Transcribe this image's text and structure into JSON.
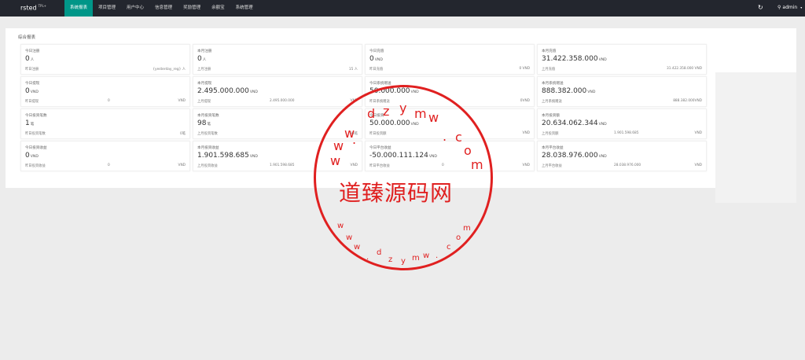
{
  "app": {
    "brand": "rsted",
    "version": "TPL+"
  },
  "nav": [
    {
      "label": "系统报表",
      "active": true
    },
    {
      "label": "项目管理",
      "active": false
    },
    {
      "label": "用户中心",
      "active": false
    },
    {
      "label": "信息管理",
      "active": false
    },
    {
      "label": "奖励管理",
      "active": false
    },
    {
      "label": "余额宝",
      "active": false
    },
    {
      "label": "系统管理",
      "active": false
    }
  ],
  "user": {
    "name": "admin"
  },
  "panel": {
    "title": "综合报表"
  },
  "cards": [
    {
      "label": "今日注册",
      "value": "0",
      "unit": "人",
      "sub_label": "昨日注册",
      "mid": "",
      "right": "{yesterday_reg} 人"
    },
    {
      "label": "本月注册",
      "value": "0",
      "unit": "人",
      "sub_label": "上月注册",
      "mid": "",
      "right": "15 人"
    },
    {
      "label": "今日充值",
      "value": "0",
      "unit": "VND",
      "sub_label": "昨日充值",
      "mid": "",
      "right": "0 VND"
    },
    {
      "label": "本月充值",
      "value": "31.422.358.000",
      "unit": "VND",
      "sub_label": "上月充值",
      "mid": "",
      "right": "31.422.358.000 VND"
    },
    {
      "label": "今日提现",
      "value": "0",
      "unit": "VND",
      "sub_label": "昨日提现",
      "mid": "0",
      "right": "VND"
    },
    {
      "label": "本月提现",
      "value": "2.495.000.000",
      "unit": "VND",
      "sub_label": "上月提现",
      "mid": "2.495.000.000",
      "right": "VND"
    },
    {
      "label": "今日系统赠送",
      "value": "50.000.000",
      "unit": "VND",
      "sub_label": "昨日系统赠送",
      "mid": "",
      "right": "0VND"
    },
    {
      "label": "本月系统赠送",
      "value": "888.382.000",
      "unit": "VND",
      "sub_label": "上月系统赠送",
      "mid": "",
      "right": "888.382.000VND"
    },
    {
      "label": "今日投资笔数",
      "value": "1",
      "unit": "笔",
      "sub_label": "昨日投资笔数",
      "mid": "",
      "right": "0笔"
    },
    {
      "label": "本月投资笔数",
      "value": "98",
      "unit": "笔",
      "sub_label": "上月投资笔数",
      "mid": "",
      "right": "98笔"
    },
    {
      "label": "今日投资",
      "value": "50.000.000",
      "unit": "VND",
      "sub_label": "昨日投资额",
      "mid": "",
      "right": "VND"
    },
    {
      "label": "本月投资额",
      "value": "20.634.062.344",
      "unit": "VND",
      "sub_label": "上月投资额",
      "mid": "1.901.598.685",
      "right": "VND"
    },
    {
      "label": "今日投资收益",
      "value": "0",
      "unit": "VND",
      "sub_label": "昨日投资收益",
      "mid": "0",
      "right": "VND"
    },
    {
      "label": "本月投资收益",
      "value": "1.901.598.685",
      "unit": "VND",
      "sub_label": "上月投资收益",
      "mid": "1.901.598.685",
      "right": "VND"
    },
    {
      "label": "今日平台收益",
      "value": "-50.000.111.124",
      "unit": "VND",
      "sub_label": "昨日平台收益",
      "mid": "0",
      "right": "VND"
    },
    {
      "label": "本月平台收益",
      "value": "28.038.976.000",
      "unit": "VND",
      "sub_label": "上月平台收益",
      "mid": "28.038.976.000",
      "right": "VND"
    }
  ],
  "watermark": {
    "title": "道臻源码网",
    "ring_top": [
      "w",
      "w",
      "w",
      ".",
      "d",
      "z",
      "y",
      "m",
      "w",
      ".",
      "c",
      "o",
      "m"
    ],
    "ring_bottom": [
      "w",
      "w",
      "w",
      ".",
      "d",
      "z",
      "y",
      "m",
      "w",
      ".",
      "c",
      "o",
      "m"
    ]
  }
}
